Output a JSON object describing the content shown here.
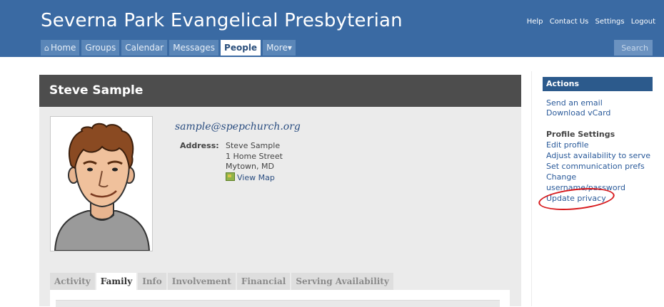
{
  "header": {
    "site_title": "Severna Park Evangelical Presbyterian",
    "top_links": [
      "Help",
      "Contact Us",
      "Settings",
      "Logout"
    ],
    "nav": [
      {
        "label": "Home",
        "icon": "home-icon"
      },
      {
        "label": "Groups"
      },
      {
        "label": "Calendar"
      },
      {
        "label": "Messages"
      },
      {
        "label": "People",
        "active": true
      },
      {
        "label": "More▾"
      }
    ],
    "search_placeholder": "Search"
  },
  "profile": {
    "name": "Steve Sample",
    "email": "sample@spepchurch.org",
    "address_label": "Address:",
    "address_lines": [
      "Steve Sample",
      "1 Home Street",
      "Mytown, MD"
    ],
    "view_map": "View Map",
    "tabs": [
      "Activity",
      "Family",
      "Info",
      "Involvement",
      "Financial",
      "Serving Availability"
    ],
    "active_tab": "Family"
  },
  "sidebar": {
    "actions_title": "Actions",
    "action_links": [
      "Send an email",
      "Download vCard"
    ],
    "profile_settings_title": "Profile Settings",
    "profile_links": [
      "Edit profile",
      "Adjust availability to serve",
      "Set communication prefs",
      "Change",
      "username/password",
      "Update privacy"
    ]
  },
  "colors": {
    "header_bg": "#3a6aa3",
    "profile_header_bg": "#4d4d4d",
    "actions_header_bg": "#2c5a8c",
    "link": "#2a5a9a",
    "annotation_circle": "#d7191c"
  }
}
